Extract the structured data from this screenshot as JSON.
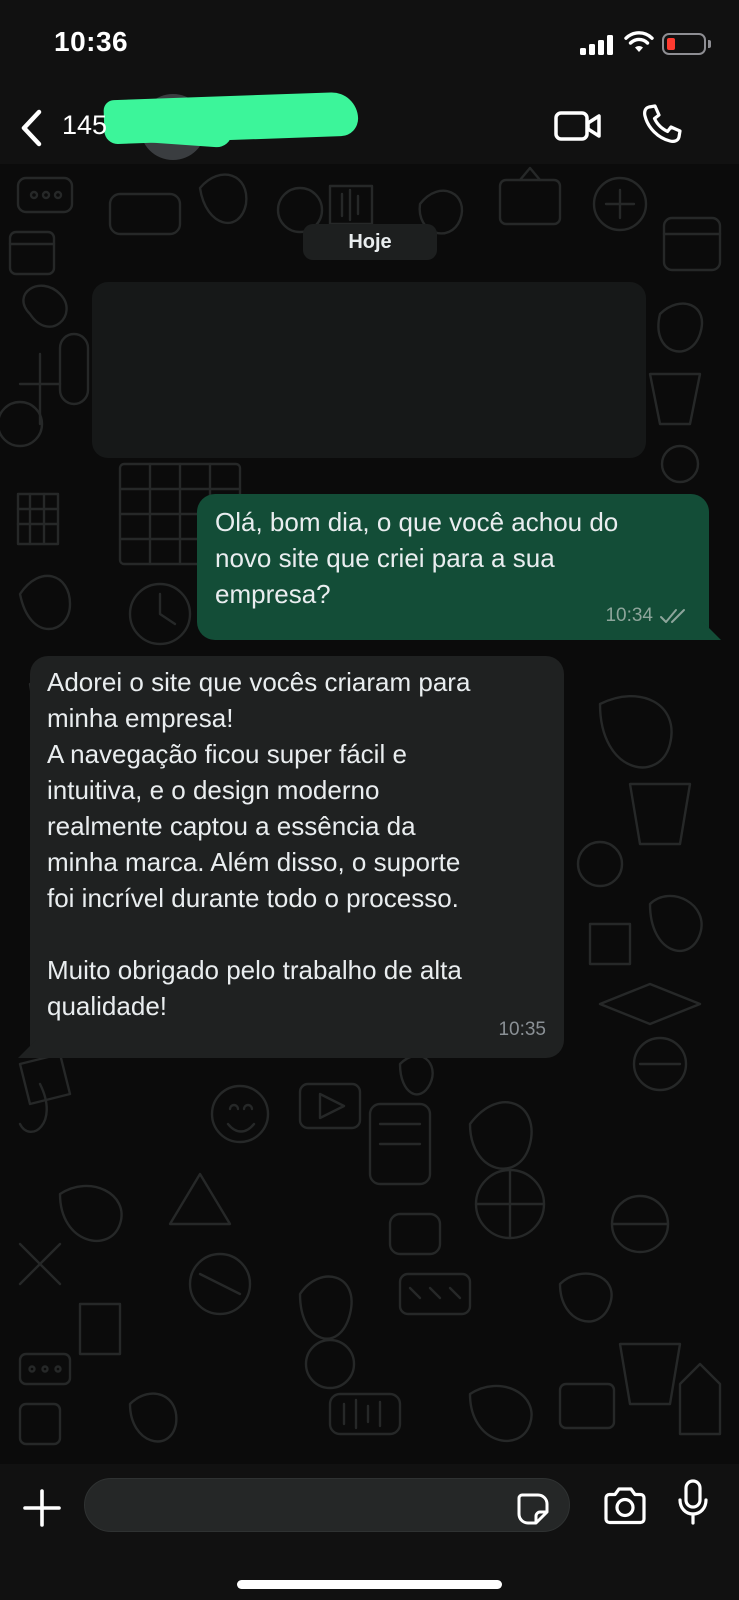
{
  "status_bar": {
    "time": "10:36",
    "battery_color": "#ff3b30"
  },
  "header": {
    "contact_name": "145",
    "back_icon": "chevron-left-icon",
    "video_icon": "video-camera-icon",
    "call_icon": "phone-icon"
  },
  "chat": {
    "date_label": "Hoje",
    "messages": [
      {
        "direction": "outgoing",
        "text": "Olá, bom dia, o que você achou do\nnovo site que criei para a sua\nempresa?",
        "time": "10:34",
        "status": "read",
        "bubble_color": "#134d37"
      },
      {
        "direction": "incoming",
        "text": "Adorei o site que vocês criaram para\nminha empresa!\nA navegação ficou super fácil e\nintuitiva, e o design moderno\nrealmente captou a essência da\nminha marca. Além disso, o suporte\nfoi incrível durante todo o processo.\n\nMuito obrigado pelo trabalho de alta\nqualidade!",
        "time": "10:35",
        "bubble_color": "#1f2121"
      }
    ]
  },
  "composer": {
    "plus_icon": "plus-icon",
    "sticker_icon": "sticker-icon",
    "camera_icon": "camera-icon",
    "mic_icon": "microphone-icon"
  }
}
